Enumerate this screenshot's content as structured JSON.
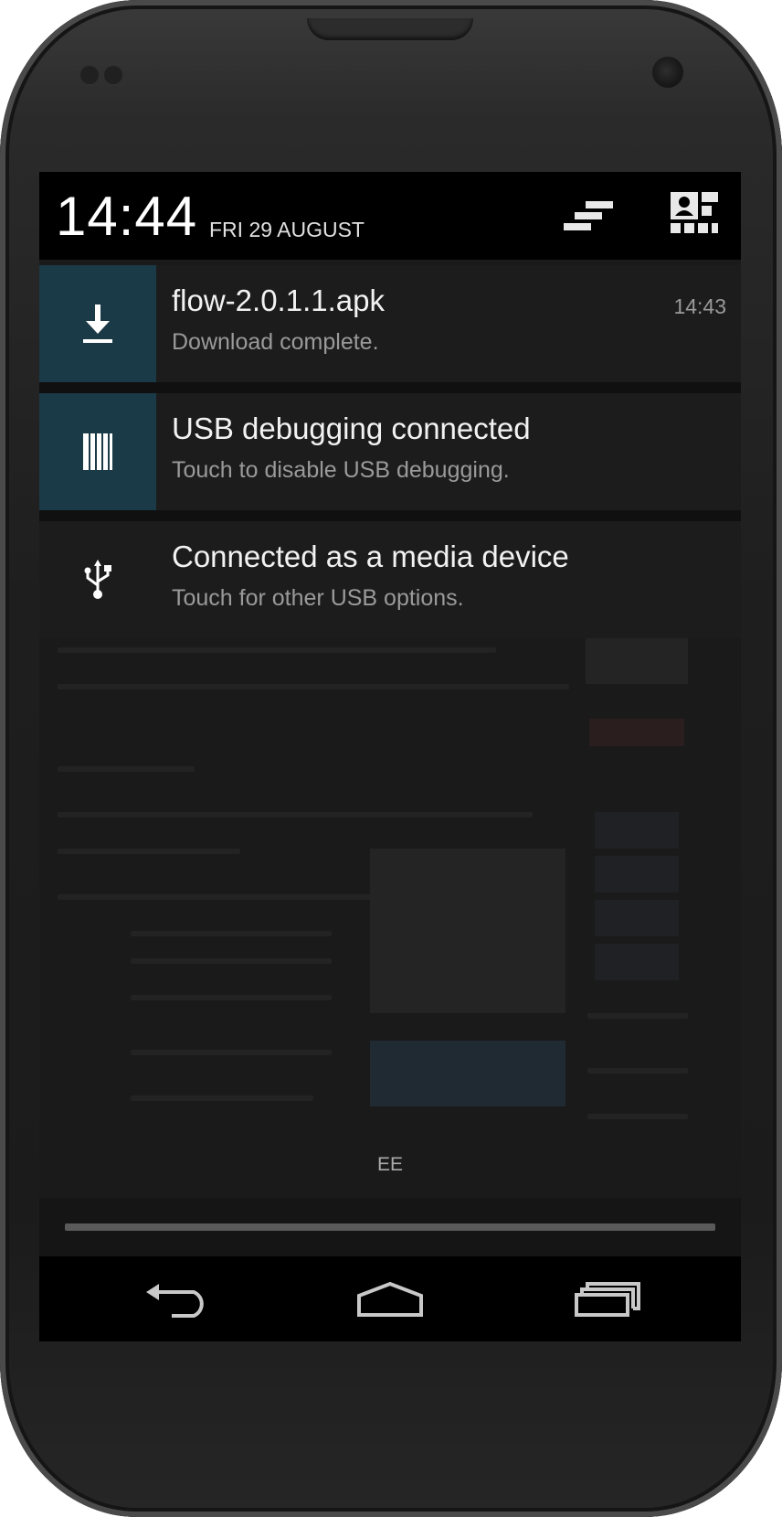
{
  "status_bar": {
    "time": "14:44",
    "date": "FRI 29 AUGUST"
  },
  "quick_settings": {
    "clear_icon": "clear-all-icon",
    "settings_icon": "quick-settings-icon"
  },
  "notifications": [
    {
      "title": "flow-2.0.1.1.apk",
      "subtitle": "Download complete.",
      "time": "14:43",
      "icon": "download-icon",
      "icon_bg": "#1b3a47"
    },
    {
      "title": "USB debugging connected",
      "subtitle": "Touch to disable USB debugging.",
      "icon": "debug-icon",
      "icon_bg": "#1b3a47"
    },
    {
      "title": "Connected as a media device",
      "subtitle": "Touch for other USB options.",
      "icon": "usb-icon",
      "icon_bg": "#1c1c1c"
    }
  ],
  "carrier": "EE",
  "navigation": {
    "back_icon": "back-icon",
    "home_icon": "home-icon",
    "recents_icon": "recents-icon"
  },
  "colors": {
    "icon_accent_bg": "#1b3a47",
    "notification_bg": "#1c1c1c",
    "status_bar_bg": "#000000"
  }
}
